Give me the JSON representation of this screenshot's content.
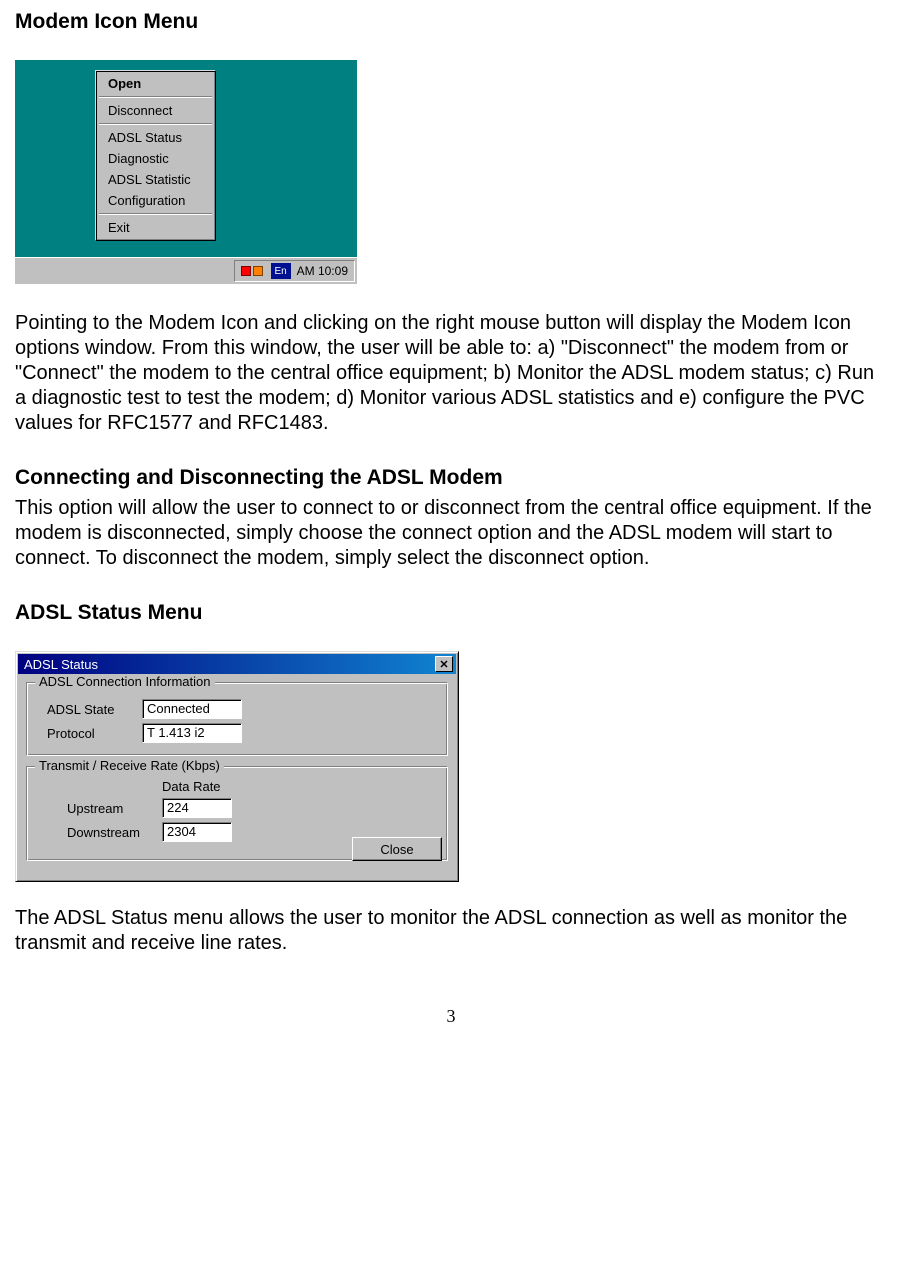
{
  "heading1": "Modem Icon Menu",
  "menu": {
    "open": "Open",
    "disconnect": "Disconnect",
    "adsl_status": "ADSL Status",
    "diagnostic": "Diagnostic",
    "adsl_statistic": "ADSL Statistic",
    "configuration": "Configuration",
    "exit": "Exit"
  },
  "tray": {
    "lang": "En",
    "time": "AM 10:09"
  },
  "para1": "Pointing to the Modem Icon and clicking on the right mouse button will display the Modem Icon options window.  From this window, the user will be able to: a) \"Disconnect\" the modem from or \"Connect\" the modem to the central office equipment; b) Monitor the ADSL modem status; c) Run a diagnostic test to test the modem;    d) Monitor various ADSL statistics and e) configure the PVC values for RFC1577 and RFC1483.",
  "heading2": "Connecting and Disconnecting the ADSL Modem",
  "para2": "This option will allow the user to connect to or disconnect from the central office equipment.  If the modem is disconnected, simply choose the connect option and the ADSL modem will start to connect.  To disconnect the modem, simply select the disconnect option.",
  "heading3": "ADSL Status Menu",
  "dialog": {
    "title": "ADSL Status",
    "group1": {
      "title": "ADSL Connection Information",
      "state_label": "ADSL State",
      "state_value": "Connected",
      "protocol_label": "Protocol",
      "protocol_value": "T 1.413 i2"
    },
    "group2": {
      "title": "Transmit / Receive Rate  (Kbps)",
      "col_header": "Data Rate",
      "upstream_label": "Upstream",
      "upstream_value": "224",
      "downstream_label": "Downstream",
      "downstream_value": "2304"
    },
    "close": "Close"
  },
  "para3": "The ADSL Status menu allows the user to monitor the ADSL connection as well as monitor the transmit and receive line rates.",
  "pagenum": "3"
}
